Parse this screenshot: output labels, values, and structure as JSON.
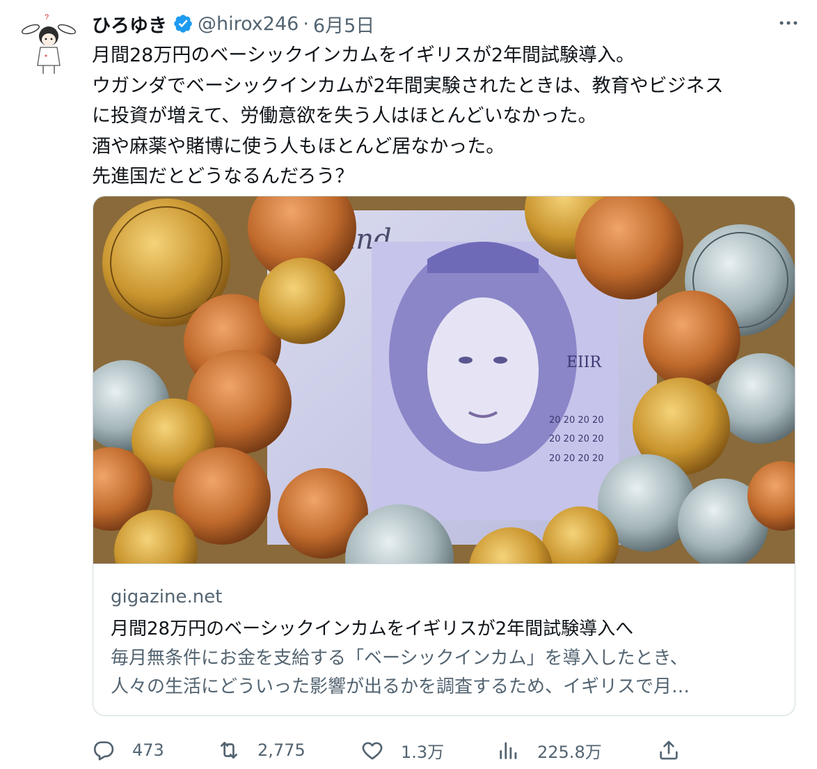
{
  "user": {
    "display_name": "ひろゆき",
    "handle": "@hirox246",
    "separator": "·",
    "date": "6月5日",
    "verified_icon": "verified-badge-icon",
    "avatar_icon": "bunny-ear-character-avatar"
  },
  "tweet": {
    "lines": [
      "月間28万円のベーシックインカムをイギリスが2年間試験導入。",
      "ウガンダでベーシックインカムが2年間実験されたときは、教育やビジネス",
      "に投資が増えて、労働意欲を失う人はほとんどいなかった。",
      "酒や麻薬や賭博に使う人もほとんど居なかった。",
      "先進国だとどうなるんだろう？"
    ]
  },
  "card": {
    "image_icon": "british-pound-banknote-and-coins-photo",
    "domain": "gigazine.net",
    "title": "月間28万円のベーシックインカムをイギリスが2年間試験導入へ",
    "description": [
      "毎月無条件にお金を支給する「ベーシックインカム」を導入したとき、",
      "人々の生活にどういった影響が出るかを調査するため、イギリスで月…"
    ]
  },
  "actions": {
    "reply_count": "473",
    "retweet_count": "2,775",
    "like_count": "1.3万",
    "view_count": "225.8万"
  },
  "colors": {
    "text_primary": "#0f1419",
    "text_secondary": "#536471",
    "verified_blue": "#1d9bf0",
    "border": "#cfd9de"
  }
}
